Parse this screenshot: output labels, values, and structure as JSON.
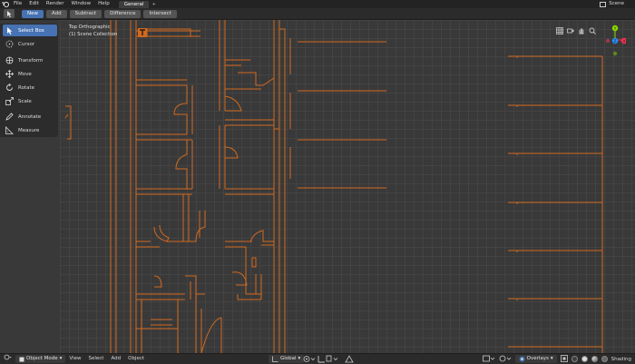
{
  "topbar": {
    "menus": [
      "File",
      "Edit",
      "Render",
      "Window",
      "Help"
    ],
    "workspace_tab": "General",
    "workspace_add": "+",
    "scene_label": "Scene"
  },
  "tool_header": {
    "modes": [
      "New",
      "Add",
      "Subtract",
      "Difference",
      "Intersect"
    ],
    "active_mode": "New"
  },
  "toolbar": {
    "tools": [
      {
        "label": "Select Box",
        "icon": "select-box-icon",
        "active": true
      },
      {
        "label": "Cursor",
        "icon": "cursor-icon"
      },
      {
        "label": "Transform",
        "icon": "transform-icon"
      },
      {
        "label": "Move",
        "icon": "move-icon"
      },
      {
        "label": "Rotate",
        "icon": "rotate-icon"
      },
      {
        "label": "Scale",
        "icon": "scale-icon"
      },
      {
        "label": "Annotate",
        "icon": "annotate-icon"
      },
      {
        "label": "Measure",
        "icon": "measure-icon"
      }
    ]
  },
  "viewport": {
    "view_name": "Top Orthographic",
    "collection": "(1) Scene Collection",
    "line_color": "#d2691e",
    "gizmo": {
      "y": "Y",
      "x": "X",
      "z": "Z"
    }
  },
  "footer": {
    "mode": "Object Mode",
    "menus": [
      "View",
      "Select",
      "Add",
      "Object"
    ],
    "orientation": "Global",
    "overlays": "Overlays",
    "shading": "Shading"
  },
  "colors": {
    "accent": "#4772b3",
    "orange": "#d2691e"
  }
}
